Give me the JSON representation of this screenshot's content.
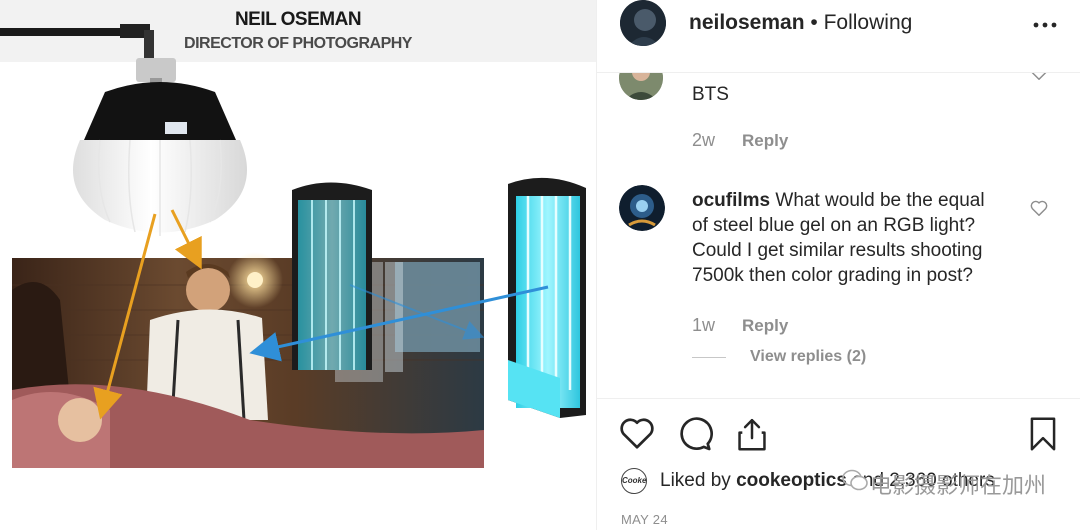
{
  "image": {
    "credit_name": "NEIL OSEMAN",
    "credit_role": "DIRECTOR OF PHOTOGRAPHY"
  },
  "header": {
    "username": "neiloseman",
    "separator": "•",
    "follow_status": "Following",
    "more_icon": "ellipsis-icon"
  },
  "comments": [
    {
      "handle": "",
      "text": "BTS",
      "age": "2w",
      "reply_label": "Reply"
    },
    {
      "handle": "ocufilms",
      "text_lines": [
        "What would be the equal",
        "of steel blue gel on an RGB light?",
        "Could I get similar results shooting",
        "7500k then color grading in post?"
      ],
      "age": "1w",
      "reply_label": "Reply",
      "view_replies": "View replies (2)"
    }
  ],
  "actions": {
    "icons": [
      "heart-icon",
      "comment-icon",
      "share-icon",
      "bookmark-icon"
    ],
    "liked_prefix": "Liked by",
    "liked_by": "cookeoptics",
    "liked_logo": "Cooke",
    "liked_suffix": "and 2,360 others",
    "date": "MAY 24"
  },
  "watermark": "电影摄影师在加州",
  "colors": {
    "arrow_orange": "#e8a020",
    "arrow_blue": "#2f8fd8",
    "tube_cyan": "#4fe0f0",
    "muted_text": "#8e8e8e"
  }
}
